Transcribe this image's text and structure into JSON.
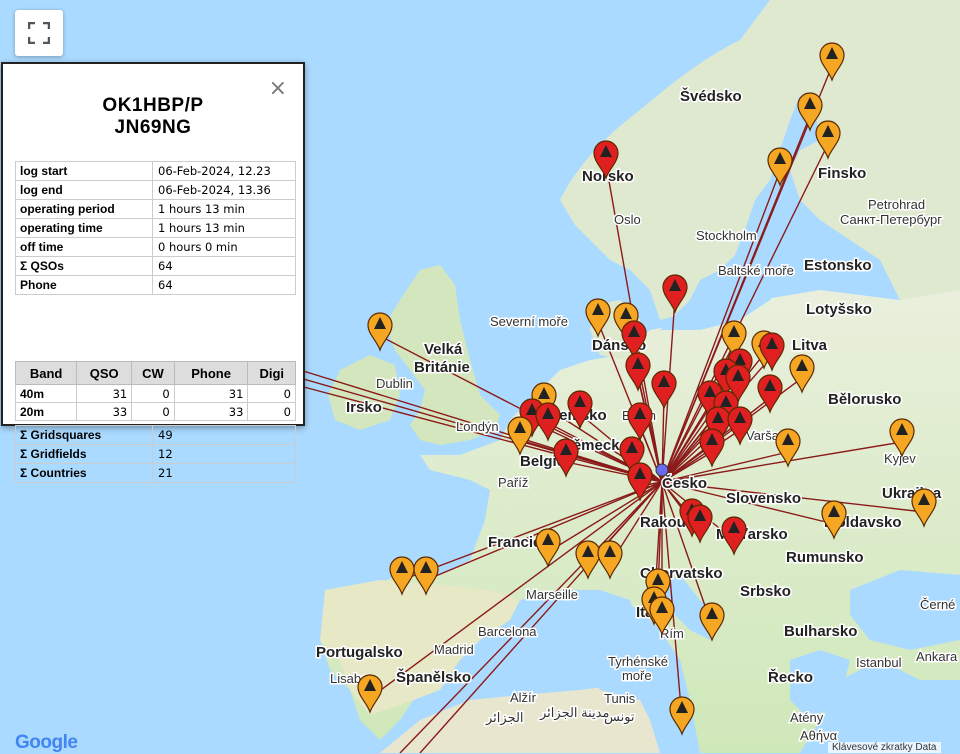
{
  "map": {
    "colors": {
      "water": "#aadaff",
      "land": "#e8eedb",
      "green_land": "#c8e6b0",
      "qso_line": "#8b1a1a",
      "pin_red": "#e02020",
      "pin_orange": "#f5a623",
      "home": "#6a6aef"
    },
    "labels": [
      {
        "text": "Švédsko",
        "bold": true
      },
      {
        "text": "Finsko",
        "bold": true
      },
      {
        "text": "Norsko",
        "bold": true
      },
      {
        "text": "Oslo",
        "bold": false
      },
      {
        "text": "Stockholm",
        "bold": false
      },
      {
        "text": "Petrohrad",
        "bold": false
      },
      {
        "text": "Санкт-Петербург",
        "bold": false
      },
      {
        "text": "Baltské moře",
        "bold": false
      },
      {
        "text": "Estonsko",
        "bold": true
      },
      {
        "text": "Lotyšsko",
        "bold": true
      },
      {
        "text": "Litva",
        "bold": true
      },
      {
        "text": "Severní moře",
        "bold": false
      },
      {
        "text": "Dánsko",
        "bold": true
      },
      {
        "text": "Velká",
        "bold": true
      },
      {
        "text": "Británie",
        "bold": true
      },
      {
        "text": "Dublin",
        "bold": false
      },
      {
        "text": "Irsko",
        "bold": true
      },
      {
        "text": "Londýn",
        "bold": false
      },
      {
        "text": "Nizozemsko",
        "bold": true
      },
      {
        "text": "Berlín",
        "bold": false
      },
      {
        "text": "Německo",
        "bold": true
      },
      {
        "text": "Belgie",
        "bold": true
      },
      {
        "text": "Varšava",
        "bold": false
      },
      {
        "text": "Bělorusko",
        "bold": true
      },
      {
        "text": "Kyjev",
        "bold": false
      },
      {
        "text": "Ukrajina",
        "bold": true
      },
      {
        "text": "Paříž",
        "bold": false
      },
      {
        "text": "Česko",
        "bold": true
      },
      {
        "text": "Slovensko",
        "bold": true
      },
      {
        "text": "Rakousko",
        "bold": true
      },
      {
        "text": "Moldavsko",
        "bold": true
      },
      {
        "text": "Maďarsko",
        "bold": true
      },
      {
        "text": "Francie",
        "bold": true
      },
      {
        "text": "Rumunsko",
        "bold": true
      },
      {
        "text": "Chorvatsko",
        "bold": true
      },
      {
        "text": "Marseille",
        "bold": false
      },
      {
        "text": "Srbsko",
        "bold": true
      },
      {
        "text": "Itálie",
        "bold": true
      },
      {
        "text": "Černé",
        "bold": false
      },
      {
        "text": "Barcelona",
        "bold": false
      },
      {
        "text": "Řím",
        "bold": false
      },
      {
        "text": "Bulharsko",
        "bold": true
      },
      {
        "text": "Portugalsko",
        "bold": true
      },
      {
        "text": "Madrid",
        "bold": false
      },
      {
        "text": "Istanbul",
        "bold": false
      },
      {
        "text": "Ankara",
        "bold": false
      },
      {
        "text": "Lisabon",
        "bold": false
      },
      {
        "text": "Španělsko",
        "bold": true
      },
      {
        "text": "Tyrhénské",
        "bold": false
      },
      {
        "text": "moře",
        "bold": false
      },
      {
        "text": "Řecko",
        "bold": true
      },
      {
        "text": "Alžír",
        "bold": false
      },
      {
        "text": "الجزائر",
        "bold": false
      },
      {
        "text": "Tunis",
        "bold": false
      },
      {
        "text": "تونس",
        "bold": false
      },
      {
        "text": "مدينة الجزائر",
        "bold": false
      },
      {
        "text": "Atény",
        "bold": false
      },
      {
        "text": "Αθήνα",
        "bold": false
      }
    ]
  },
  "info_window": {
    "callsign": "OK1HBP/P",
    "locator": "JN69NG",
    "close_label": "×",
    "summary": [
      {
        "key": "log start",
        "value": "06-Feb-2024, 12.23"
      },
      {
        "key": "log end",
        "value": "06-Feb-2024, 13.36"
      },
      {
        "key": "operating period",
        "value": "1 hours 13 min"
      },
      {
        "key": "operating time",
        "value": "1 hours 13 min"
      },
      {
        "key": "off time",
        "value": "0 hours 0 min"
      },
      {
        "key": "Σ QSOs",
        "value": "64"
      },
      {
        "key": "Phone",
        "value": "64"
      }
    ],
    "band_headers": [
      "Band",
      "QSO",
      "CW",
      "Phone",
      "Digi"
    ],
    "bands": [
      {
        "band": "40m",
        "qso": "31",
        "cw": "0",
        "phone": "31",
        "digi": "0"
      },
      {
        "band": "20m",
        "qso": "33",
        "cw": "0",
        "phone": "33",
        "digi": "0"
      }
    ],
    "totals": [
      {
        "key": "Σ Gridsquares",
        "value": "49"
      },
      {
        "key": "Σ Gridfields",
        "value": "12"
      },
      {
        "key": "Σ Countries",
        "value": "21"
      }
    ]
  },
  "footer": {
    "logo": "Google",
    "attribution": "Klávesové zkratky   Data"
  }
}
